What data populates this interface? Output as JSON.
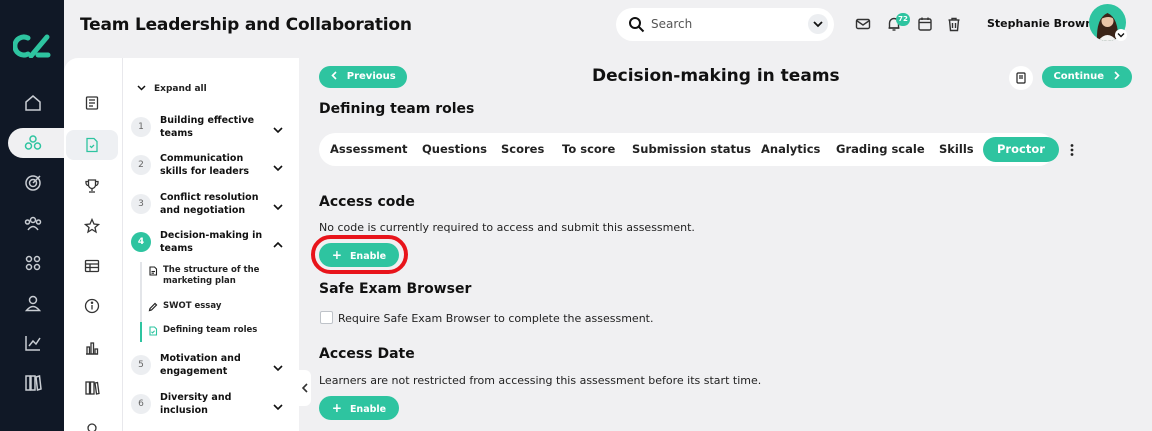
{
  "app": {
    "title": "Team Leadership and Collaboration"
  },
  "header": {
    "search_placeholder": "Search",
    "notification_count": "72",
    "user_name": "Stephanie Brown"
  },
  "outline": {
    "expand_all": "Expand all",
    "modules": [
      {
        "num": "1",
        "title": "Building effective teams",
        "expanded": false
      },
      {
        "num": "2",
        "title": "Communication skills for leaders",
        "expanded": false
      },
      {
        "num": "3",
        "title": "Conflict resolution and negotiation",
        "expanded": false
      },
      {
        "num": "4",
        "title": "Decision-making in teams",
        "expanded": true
      },
      {
        "num": "5",
        "title": "Motivation and engagement",
        "expanded": false
      },
      {
        "num": "6",
        "title": "Diversity and inclusion",
        "expanded": false
      }
    ],
    "subitems": [
      {
        "title": "The structure of the marketing plan",
        "icon": "document-icon"
      },
      {
        "title": "SWOT essay",
        "icon": "pencil-icon"
      },
      {
        "title": "Defining team roles",
        "icon": "assessment-icon"
      }
    ]
  },
  "main": {
    "previous_label": "Previous",
    "continue_label": "Continue",
    "page_title": "Decision-making in teams",
    "section_title": "Defining team roles",
    "tabs": [
      "Assessment",
      "Questions",
      "Scores",
      "To score",
      "Submission status",
      "Analytics",
      "Grading scale",
      "Skills",
      "Proctor"
    ],
    "active_tab": "Proctor",
    "access_code": {
      "title": "Access code",
      "description": "No code is currently required to access and submit this assessment.",
      "button": "Enable"
    },
    "safe_exam": {
      "title": "Safe Exam Browser",
      "checkbox_label": "Require Safe Exam Browser to complete the assessment.",
      "checked": false
    },
    "access_date": {
      "title": "Access Date",
      "description": "Learners are not restricted from accessing this assessment before its start time.",
      "button": "Enable"
    }
  },
  "colors": {
    "accent": "#2ec4a0",
    "rail": "#101826",
    "highlight": "#e8141b"
  }
}
